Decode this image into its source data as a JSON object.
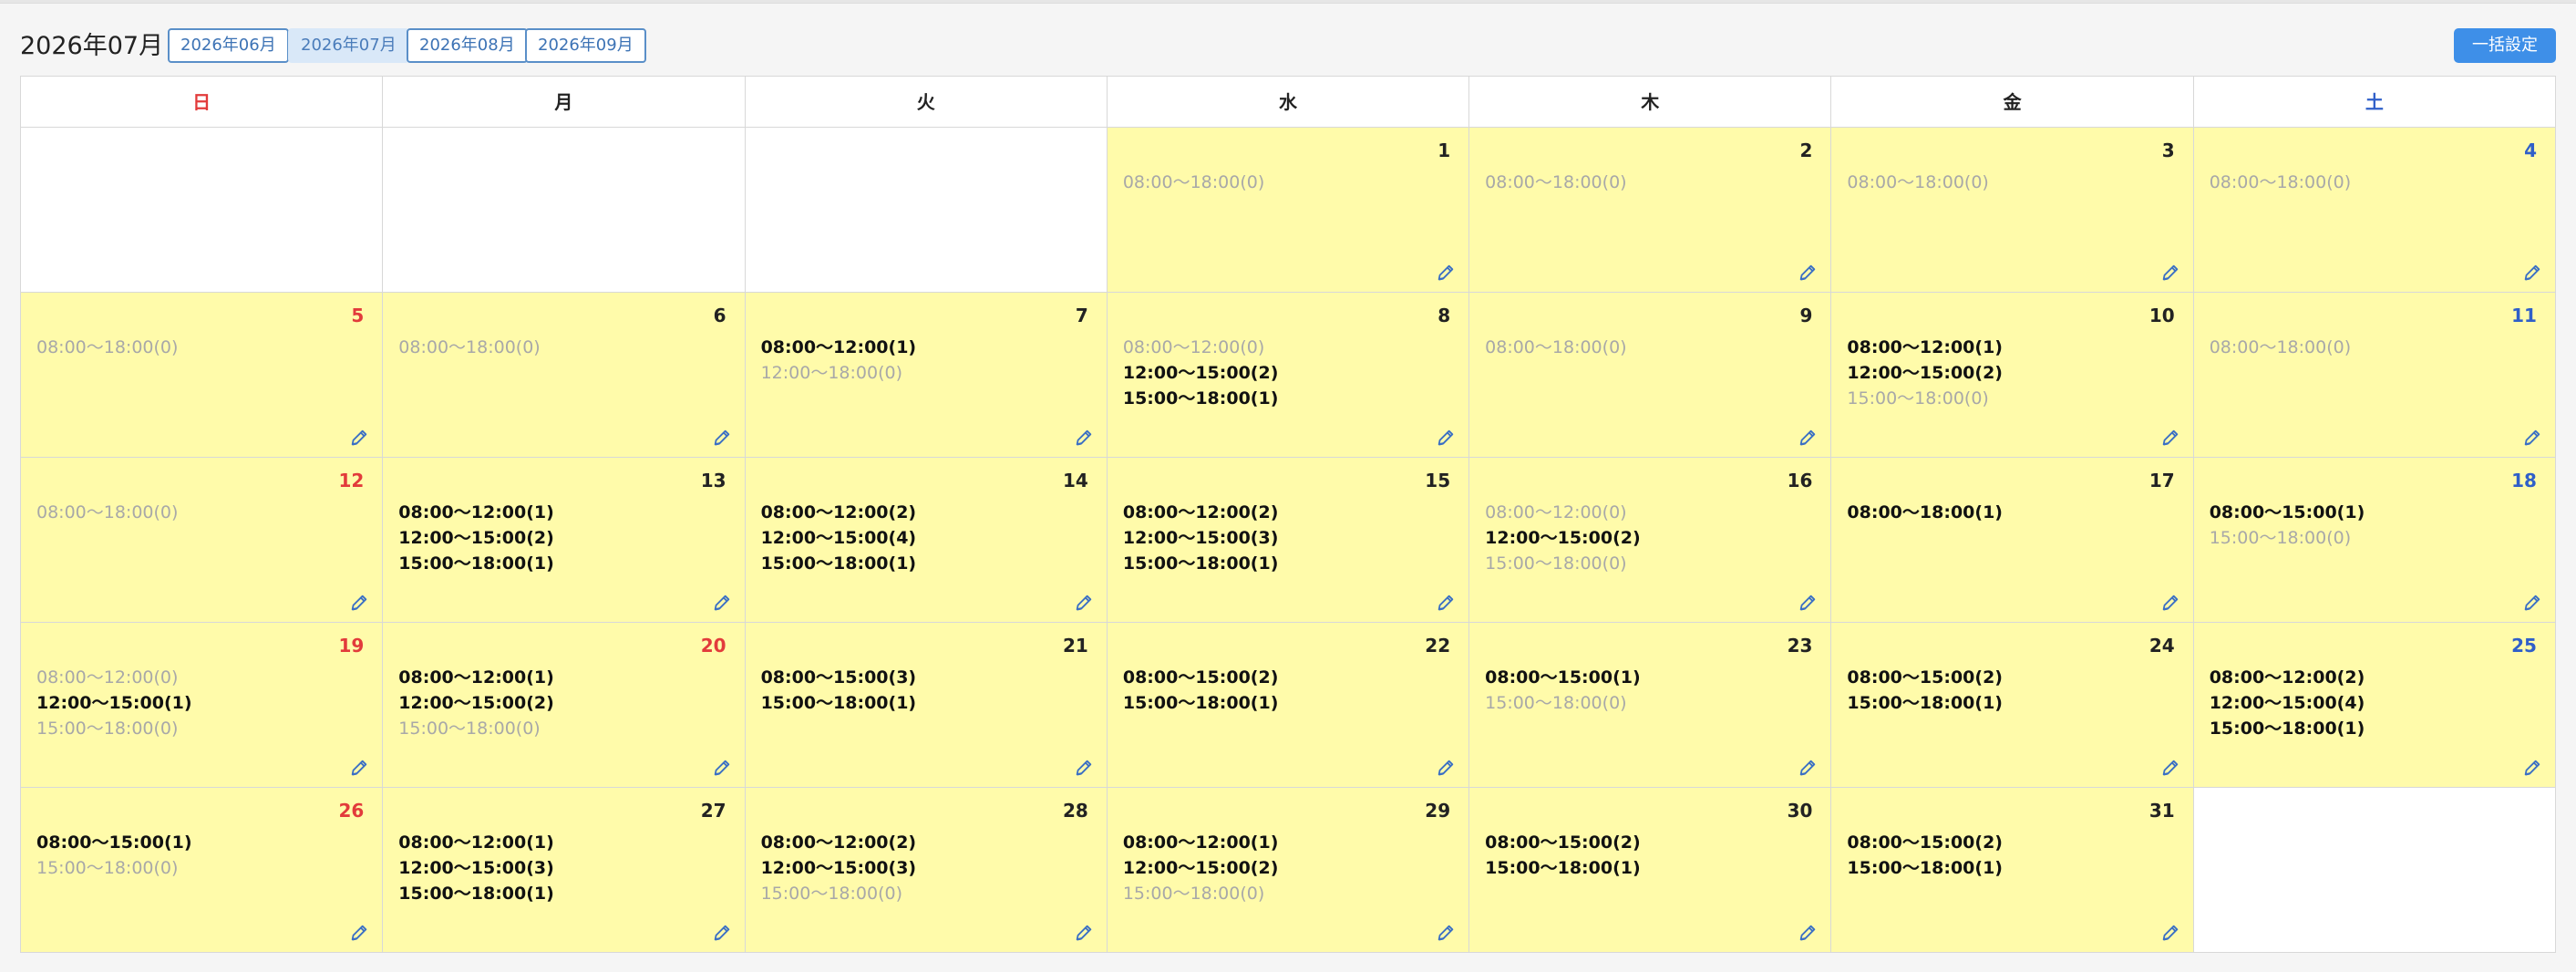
{
  "header": {
    "title": "2026年07月",
    "bulk_label": "一括設定"
  },
  "month_tabs": [
    {
      "label": "2026年06月",
      "active": false
    },
    {
      "label": "2026年07月",
      "active": true
    },
    {
      "label": "2026年08月",
      "active": false
    },
    {
      "label": "2026年09月",
      "active": false
    }
  ],
  "colors": {
    "sunday": "#e23b3b",
    "saturday": "#2f5fc9",
    "active_cell": "#fffbaa",
    "accent": "#3e8fe8"
  },
  "weekdays": [
    "日",
    "月",
    "火",
    "水",
    "木",
    "金",
    "土"
  ],
  "cells": [
    null,
    null,
    null,
    {
      "day": "1",
      "slots": [
        {
          "text": "08:00〜18:00(0)",
          "booked": false
        }
      ]
    },
    {
      "day": "2",
      "slots": [
        {
          "text": "08:00〜18:00(0)",
          "booked": false
        }
      ]
    },
    {
      "day": "3",
      "slots": [
        {
          "text": "08:00〜18:00(0)",
          "booked": false
        }
      ]
    },
    {
      "day": "4",
      "slots": [
        {
          "text": "08:00〜18:00(0)",
          "booked": false
        }
      ]
    },
    {
      "day": "5",
      "slots": [
        {
          "text": "08:00〜18:00(0)",
          "booked": false
        }
      ]
    },
    {
      "day": "6",
      "slots": [
        {
          "text": "08:00〜18:00(0)",
          "booked": false
        }
      ]
    },
    {
      "day": "7",
      "slots": [
        {
          "text": "08:00〜12:00(1)",
          "booked": true
        },
        {
          "text": "12:00〜18:00(0)",
          "booked": false
        }
      ]
    },
    {
      "day": "8",
      "slots": [
        {
          "text": "08:00〜12:00(0)",
          "booked": false
        },
        {
          "text": "12:00〜15:00(2)",
          "booked": true
        },
        {
          "text": "15:00〜18:00(1)",
          "booked": true
        }
      ]
    },
    {
      "day": "9",
      "slots": [
        {
          "text": "08:00〜18:00(0)",
          "booked": false
        }
      ]
    },
    {
      "day": "10",
      "slots": [
        {
          "text": "08:00〜12:00(1)",
          "booked": true
        },
        {
          "text": "12:00〜15:00(2)",
          "booked": true
        },
        {
          "text": "15:00〜18:00(0)",
          "booked": false
        }
      ]
    },
    {
      "day": "11",
      "slots": [
        {
          "text": "08:00〜18:00(0)",
          "booked": false
        }
      ]
    },
    {
      "day": "12",
      "slots": [
        {
          "text": "08:00〜18:00(0)",
          "booked": false
        }
      ]
    },
    {
      "day": "13",
      "slots": [
        {
          "text": "08:00〜12:00(1)",
          "booked": true
        },
        {
          "text": "12:00〜15:00(2)",
          "booked": true
        },
        {
          "text": "15:00〜18:00(1)",
          "booked": true
        }
      ]
    },
    {
      "day": "14",
      "slots": [
        {
          "text": "08:00〜12:00(2)",
          "booked": true
        },
        {
          "text": "12:00〜15:00(4)",
          "booked": true
        },
        {
          "text": "15:00〜18:00(1)",
          "booked": true
        }
      ]
    },
    {
      "day": "15",
      "slots": [
        {
          "text": "08:00〜12:00(2)",
          "booked": true
        },
        {
          "text": "12:00〜15:00(3)",
          "booked": true
        },
        {
          "text": "15:00〜18:00(1)",
          "booked": true
        }
      ]
    },
    {
      "day": "16",
      "slots": [
        {
          "text": "08:00〜12:00(0)",
          "booked": false
        },
        {
          "text": "12:00〜15:00(2)",
          "booked": true
        },
        {
          "text": "15:00〜18:00(0)",
          "booked": false
        }
      ]
    },
    {
      "day": "17",
      "slots": [
        {
          "text": "08:00〜18:00(1)",
          "booked": true
        }
      ]
    },
    {
      "day": "18",
      "slots": [
        {
          "text": "08:00〜15:00(1)",
          "booked": true
        },
        {
          "text": "15:00〜18:00(0)",
          "booked": false
        }
      ]
    },
    {
      "day": "19",
      "slots": [
        {
          "text": "08:00〜12:00(0)",
          "booked": false
        },
        {
          "text": "12:00〜15:00(1)",
          "booked": true
        },
        {
          "text": "15:00〜18:00(0)",
          "booked": false
        }
      ]
    },
    {
      "day": "20",
      "holiday": true,
      "slots": [
        {
          "text": "08:00〜12:00(1)",
          "booked": true
        },
        {
          "text": "12:00〜15:00(2)",
          "booked": true
        },
        {
          "text": "15:00〜18:00(0)",
          "booked": false
        }
      ]
    },
    {
      "day": "21",
      "slots": [
        {
          "text": "08:00〜15:00(3)",
          "booked": true
        },
        {
          "text": "15:00〜18:00(1)",
          "booked": true
        }
      ]
    },
    {
      "day": "22",
      "slots": [
        {
          "text": "08:00〜15:00(2)",
          "booked": true
        },
        {
          "text": "15:00〜18:00(1)",
          "booked": true
        }
      ]
    },
    {
      "day": "23",
      "slots": [
        {
          "text": "08:00〜15:00(1)",
          "booked": true
        },
        {
          "text": "15:00〜18:00(0)",
          "booked": false
        }
      ]
    },
    {
      "day": "24",
      "slots": [
        {
          "text": "08:00〜15:00(2)",
          "booked": true
        },
        {
          "text": "15:00〜18:00(1)",
          "booked": true
        }
      ]
    },
    {
      "day": "25",
      "slots": [
        {
          "text": "08:00〜12:00(2)",
          "booked": true
        },
        {
          "text": "12:00〜15:00(4)",
          "booked": true
        },
        {
          "text": "15:00〜18:00(1)",
          "booked": true
        }
      ]
    },
    {
      "day": "26",
      "slots": [
        {
          "text": "08:00〜15:00(1)",
          "booked": true
        },
        {
          "text": "15:00〜18:00(0)",
          "booked": false
        }
      ]
    },
    {
      "day": "27",
      "slots": [
        {
          "text": "08:00〜12:00(1)",
          "booked": true
        },
        {
          "text": "12:00〜15:00(3)",
          "booked": true
        },
        {
          "text": "15:00〜18:00(1)",
          "booked": true
        }
      ]
    },
    {
      "day": "28",
      "slots": [
        {
          "text": "08:00〜12:00(2)",
          "booked": true
        },
        {
          "text": "12:00〜15:00(3)",
          "booked": true
        },
        {
          "text": "15:00〜18:00(0)",
          "booked": false
        }
      ]
    },
    {
      "day": "29",
      "slots": [
        {
          "text": "08:00〜12:00(1)",
          "booked": true
        },
        {
          "text": "12:00〜15:00(2)",
          "booked": true
        },
        {
          "text": "15:00〜18:00(0)",
          "booked": false
        }
      ]
    },
    {
      "day": "30",
      "slots": [
        {
          "text": "08:00〜15:00(2)",
          "booked": true
        },
        {
          "text": "15:00〜18:00(1)",
          "booked": true
        }
      ]
    },
    {
      "day": "31",
      "slots": [
        {
          "text": "08:00〜15:00(2)",
          "booked": true
        },
        {
          "text": "15:00〜18:00(1)",
          "booked": true
        }
      ]
    },
    null
  ],
  "edit_icon": "pencil-icon"
}
